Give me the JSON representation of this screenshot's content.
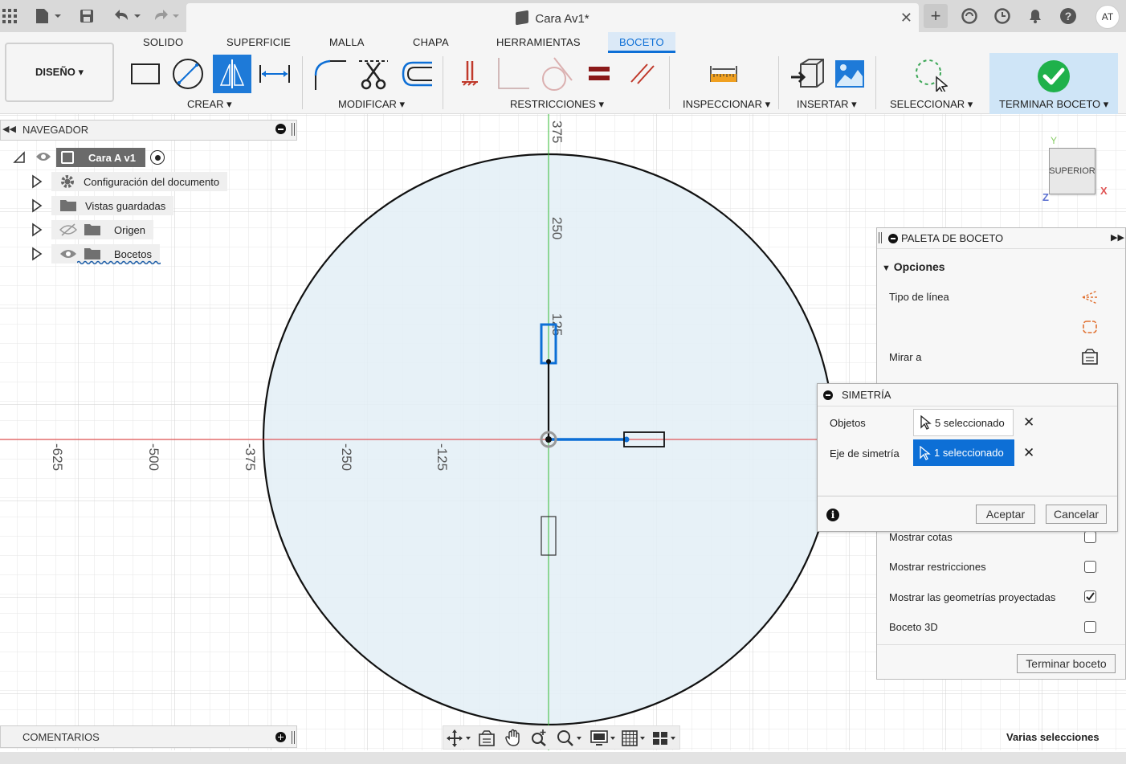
{
  "window": {
    "title": "Cara Av1*"
  },
  "user": {
    "initials": "AT"
  },
  "ribbon": {
    "tabs": [
      "SOLIDO",
      "SUPERFICIE",
      "MALLA",
      "CHAPA",
      "HERRAMIENTAS",
      "BOCETO"
    ],
    "active_tab": "BOCETO",
    "workspace": "DISEÑO ▾",
    "groups": [
      "CREAR ▾",
      "MODIFICAR ▾",
      "RESTRICCIONES ▾",
      "INSPECCIONAR ▾",
      "INSERTAR ▾",
      "SELECCIONAR ▾",
      "TERMINAR BOCETO ▾"
    ]
  },
  "navigator": {
    "title": "NAVEGADOR",
    "root": "Cara A v1",
    "items": [
      "Configuración del documento",
      "Vistas guardadas",
      "Origen",
      "Bocetos"
    ]
  },
  "axis": {
    "vertical_ticks": [
      "375",
      "250",
      "125"
    ],
    "horizontal_ticks": [
      "-625",
      "-500",
      "-375",
      "-250",
      "-125"
    ]
  },
  "viewcube": {
    "face": "SUPERIOR",
    "x": "X",
    "y": "Y",
    "z": "Z"
  },
  "palette": {
    "title": "PALETA DE BOCETO",
    "section": "Opciones",
    "rows": {
      "line_type": "Tipo de línea",
      "look_at": "Mirar a",
      "show_dims": "Mostrar cotas",
      "show_constraints": "Mostrar restricciones",
      "show_projected": "Mostrar las geometrías proyectadas",
      "sketch3d": "Boceto 3D"
    },
    "checks": {
      "show_dims": false,
      "show_constraints": false,
      "show_projected": true,
      "sketch3d": false
    },
    "finish": "Terminar boceto"
  },
  "symmetry": {
    "title": "SIMETRÍA",
    "objects_label": "Objetos",
    "objects_value": "5 seleccionado",
    "axis_label": "Eje de simetría",
    "axis_value": "1 seleccionado",
    "ok": "Aceptar",
    "cancel": "Cancelar"
  },
  "comments": {
    "title": "COMENTARIOS"
  },
  "status": "Varias selecciones",
  "colors": {
    "accent": "#0d6fd6",
    "sketch_fill": "#e3eef6",
    "axis_red": "#e03030",
    "axis_green": "#33bb33",
    "ok_green": "#1fb14b"
  }
}
